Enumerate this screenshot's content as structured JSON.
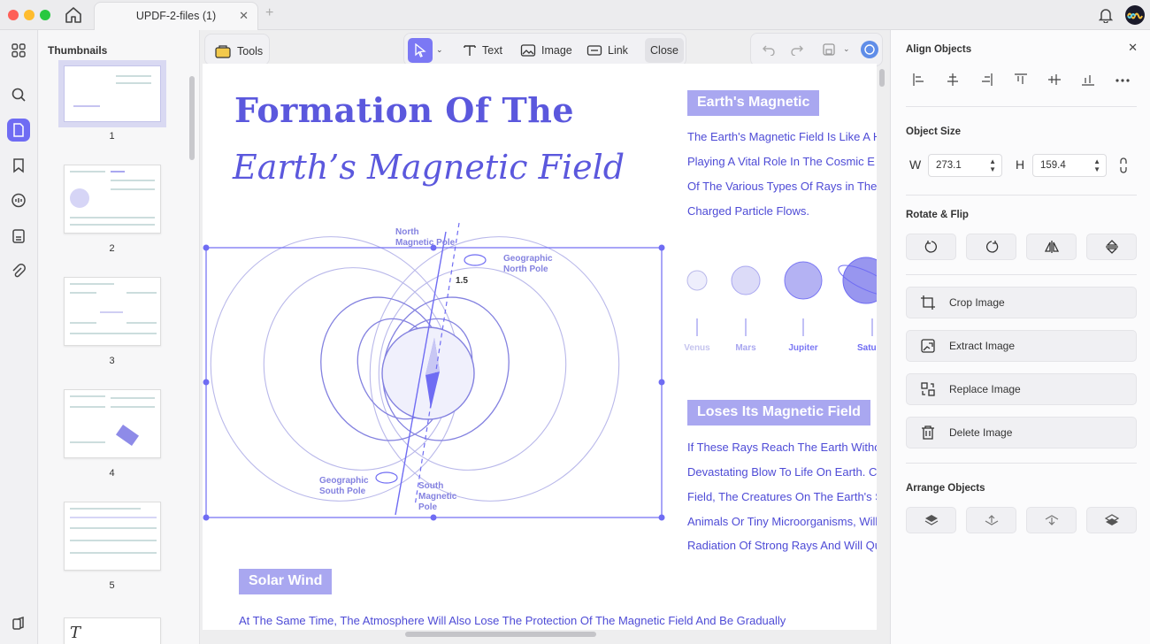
{
  "window": {
    "tab_title": "UPDF-2-files (1)"
  },
  "colors": {
    "accent": "#6f6cf3",
    "heading": "#5b58dd",
    "badge": "#a9a7f0"
  },
  "thumbnails": {
    "title": "Thumbnails",
    "pages": [
      "1",
      "2",
      "3",
      "4",
      "5"
    ],
    "selected": "1"
  },
  "toolbar": {
    "tools": "Tools",
    "text": "Text",
    "image": "Image",
    "link": "Link",
    "close": "Close"
  },
  "right_panel": {
    "align_title": "Align Objects",
    "size_title": "Object Size",
    "w_label": "W",
    "w_value": "273.1",
    "h_label": "H",
    "h_value": "159.4",
    "rotate_title": "Rotate & Flip",
    "actions": [
      "Crop Image",
      "Extract Image",
      "Replace Image",
      "Delete Image"
    ],
    "arrange_title": "Arrange Objects"
  },
  "document": {
    "title_line1": "Formation Of The",
    "title_line2": "Earth’s Magnetic Field",
    "earth_badge": "Earth's Magnetic",
    "earth_text": [
      "The Earth's Magnetic Field Is Like A H",
      "Playing A Vital Role In The Cosmic E",
      "Of The Various Types Of Rays in The",
      "Charged Particle Flows."
    ],
    "planets": [
      "Venus",
      "Mars",
      "Jupiter",
      "Satu"
    ],
    "loses_badge": "Loses Its Magnetic Field",
    "loses_text": [
      "If These Rays Reach The Earth Witho",
      "Devastating Blow To Life On Earth. C",
      "Field, The Creatures On The Earth's S",
      "Animals Or Tiny Microorganisms, Will",
      "Radiation Of Strong Rays And Will Qu"
    ],
    "solar_badge": "Solar Wind",
    "solar_text": "At The Same Time, The Atmosphere Will Also Lose The Protection Of The Magnetic Field And Be Gradually",
    "diagram": {
      "north_mag": [
        "North",
        "Magnetic Pole"
      ],
      "geo_north": [
        "Geographic",
        "North Pole"
      ],
      "angle": "1.5",
      "geo_south": [
        "Geographic",
        "South Pole"
      ],
      "south_mag": [
        "South",
        "Magnetic",
        "Pole"
      ]
    }
  }
}
